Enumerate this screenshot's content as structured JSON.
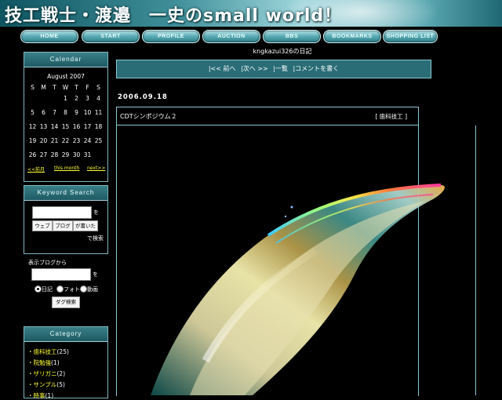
{
  "banner": {
    "title": "技工戦士・渡邉　一史のsmall world！"
  },
  "nav": [
    {
      "label": "HOME"
    },
    {
      "label": "START"
    },
    {
      "label": "PROFILE"
    },
    {
      "label": "AUCTION"
    },
    {
      "label": "BBS"
    },
    {
      "label": "BOOKMARKS"
    },
    {
      "label": "SHOPPING LIST"
    }
  ],
  "calendar": {
    "heading": "Calendar",
    "month": "August 2007",
    "weekdays": [
      "S",
      "M",
      "T",
      "W",
      "T",
      "F",
      "S"
    ],
    "rows": [
      [
        "",
        "",
        "",
        "1",
        "2",
        "3",
        "4"
      ],
      [
        "5",
        "6",
        "7",
        "8",
        "9",
        "10",
        "11"
      ],
      [
        "12",
        "13",
        "14",
        "15",
        "16",
        "17",
        "18"
      ],
      [
        "19",
        "20",
        "21",
        "22",
        "23",
        "24",
        "25"
      ],
      [
        "26",
        "27",
        "28",
        "29",
        "30",
        "31",
        ""
      ]
    ],
    "prev": "<<前月",
    "this": "this month",
    "next": "next>>"
  },
  "search": {
    "heading": "Keyword Search",
    "suffix": "を",
    "btn_web": "ウェブ",
    "btn_blog": "ブログ",
    "btn_read": "が書いた",
    "tail": "で検索",
    "blog_label": "表示ブログから",
    "suffix2": "を",
    "radio": [
      {
        "label": "日記",
        "on": true
      },
      {
        "label": "フォト",
        "on": false
      },
      {
        "label": "動画",
        "on": false
      }
    ],
    "submit": "ダグ検索"
  },
  "category": {
    "heading": "Category",
    "items": [
      {
        "name": "歯科技工",
        "count": "(25)"
      },
      {
        "name": "院勉強",
        "count": "(1)"
      },
      {
        "name": "ザリガニ",
        "count": "(2)"
      },
      {
        "name": "サンプル",
        "count": "(5)"
      },
      {
        "name": "時事",
        "count": "(1)"
      }
    ]
  },
  "main": {
    "blogname": "kngkazui326の日記",
    "pager": {
      "first": "|<< 前へ",
      "next": "|次へ >>",
      "list": "|一覧",
      "comment": "|コメントを書く"
    },
    "date": "2006.09.18",
    "post_title": "CDTシンポジウム２",
    "post_category": "[ 歯科技工 ]"
  }
}
